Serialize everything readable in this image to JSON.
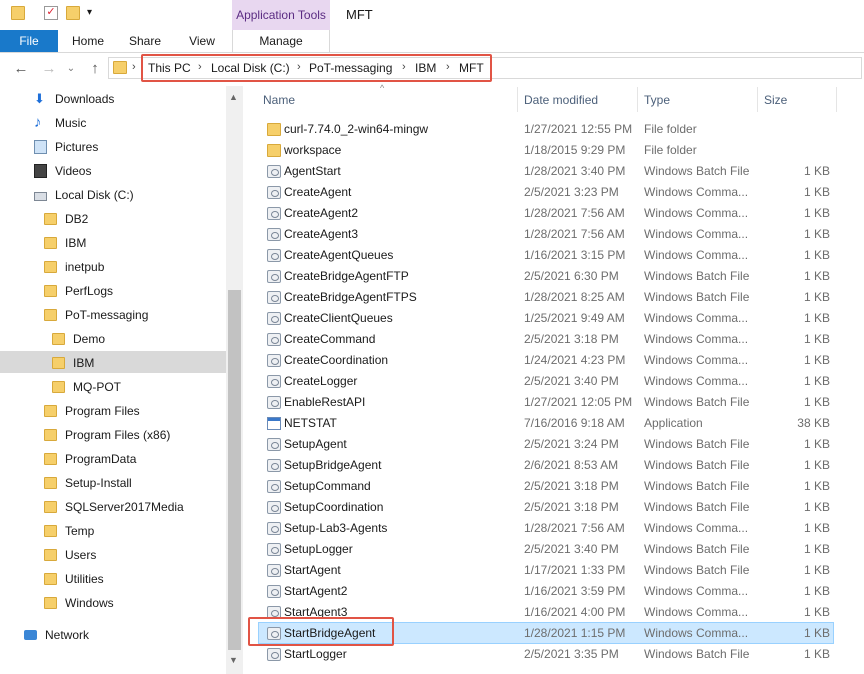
{
  "titlebar": {
    "title": "MFT",
    "contextual_tab": "Application Tools"
  },
  "ribbon": {
    "tabs": [
      "File",
      "Home",
      "Share",
      "View",
      "Manage"
    ]
  },
  "address": {
    "crumbs": [
      "This PC",
      "Local Disk (C:)",
      "PoT-messaging",
      "IBM",
      "MFT"
    ]
  },
  "nav": {
    "items": [
      {
        "label": "Downloads",
        "icon": "download-arrow-icon"
      },
      {
        "label": "Music",
        "icon": "music-note-icon"
      },
      {
        "label": "Pictures",
        "icon": "pictures-icon"
      },
      {
        "label": "Videos",
        "icon": "videos-icon"
      },
      {
        "label": "Local Disk (C:)",
        "icon": "drive-icon"
      },
      {
        "label": "DB2",
        "icon": "folder-icon"
      },
      {
        "label": "IBM",
        "icon": "folder-icon"
      },
      {
        "label": "inetpub",
        "icon": "folder-icon"
      },
      {
        "label": "PerfLogs",
        "icon": "folder-icon"
      },
      {
        "label": "PoT-messaging",
        "icon": "folder-icon"
      },
      {
        "label": "Demo",
        "icon": "folder-icon"
      },
      {
        "label": "IBM",
        "icon": "folder-icon"
      },
      {
        "label": "MQ-POT",
        "icon": "folder-icon"
      },
      {
        "label": "Program Files",
        "icon": "folder-icon"
      },
      {
        "label": "Program Files (x86)",
        "icon": "folder-icon"
      },
      {
        "label": "ProgramData",
        "icon": "folder-icon"
      },
      {
        "label": "Setup-Install",
        "icon": "folder-icon"
      },
      {
        "label": "SQLServer2017Media",
        "icon": "folder-icon"
      },
      {
        "label": "Temp",
        "icon": "folder-icon"
      },
      {
        "label": "Users",
        "icon": "folder-icon"
      },
      {
        "label": "Utilities",
        "icon": "folder-icon"
      },
      {
        "label": "Windows",
        "icon": "folder-icon"
      },
      {
        "label": "Network",
        "icon": "network-icon"
      }
    ]
  },
  "columns": {
    "name": "Name",
    "date": "Date modified",
    "type": "Type",
    "size": "Size"
  },
  "files": [
    {
      "name": "curl-7.74.0_2-win64-mingw",
      "date": "1/27/2021 12:55 PM",
      "type": "File folder",
      "size": "",
      "icon": "folder-icon"
    },
    {
      "name": "workspace",
      "date": "1/18/2015 9:29 PM",
      "type": "File folder",
      "size": "",
      "icon": "folder-icon"
    },
    {
      "name": "AgentStart",
      "date": "1/28/2021 3:40 PM",
      "type": "Windows Batch File",
      "size": "1 KB",
      "icon": "batch-file-icon"
    },
    {
      "name": "CreateAgent",
      "date": "2/5/2021 3:23 PM",
      "type": "Windows Comma...",
      "size": "1 KB",
      "icon": "batch-file-icon"
    },
    {
      "name": "CreateAgent2",
      "date": "1/28/2021 7:56 AM",
      "type": "Windows Comma...",
      "size": "1 KB",
      "icon": "batch-file-icon"
    },
    {
      "name": "CreateAgent3",
      "date": "1/28/2021 7:56 AM",
      "type": "Windows Comma...",
      "size": "1 KB",
      "icon": "batch-file-icon"
    },
    {
      "name": "CreateAgentQueues",
      "date": "1/16/2021 3:15 PM",
      "type": "Windows Comma...",
      "size": "1 KB",
      "icon": "batch-file-icon"
    },
    {
      "name": "CreateBridgeAgentFTP",
      "date": "2/5/2021 6:30 PM",
      "type": "Windows Batch File",
      "size": "1 KB",
      "icon": "batch-file-icon"
    },
    {
      "name": "CreateBridgeAgentFTPS",
      "date": "1/28/2021 8:25 AM",
      "type": "Windows Batch File",
      "size": "1 KB",
      "icon": "batch-file-icon"
    },
    {
      "name": "CreateClientQueues",
      "date": "1/25/2021 9:49 AM",
      "type": "Windows Comma...",
      "size": "1 KB",
      "icon": "batch-file-icon"
    },
    {
      "name": "CreateCommand",
      "date": "2/5/2021 3:18 PM",
      "type": "Windows Comma...",
      "size": "1 KB",
      "icon": "batch-file-icon"
    },
    {
      "name": "CreateCoordination",
      "date": "1/24/2021 4:23 PM",
      "type": "Windows Comma...",
      "size": "1 KB",
      "icon": "batch-file-icon"
    },
    {
      "name": "CreateLogger",
      "date": "2/5/2021 3:40 PM",
      "type": "Windows Comma...",
      "size": "1 KB",
      "icon": "batch-file-icon"
    },
    {
      "name": "EnableRestAPI",
      "date": "1/27/2021 12:05 PM",
      "type": "Windows Batch File",
      "size": "1 KB",
      "icon": "batch-file-icon"
    },
    {
      "name": "NETSTAT",
      "date": "7/16/2016 9:18 AM",
      "type": "Application",
      "size": "38 KB",
      "icon": "application-icon"
    },
    {
      "name": "SetupAgent",
      "date": "2/5/2021 3:24 PM",
      "type": "Windows Batch File",
      "size": "1 KB",
      "icon": "batch-file-icon"
    },
    {
      "name": "SetupBridgeAgent",
      "date": "2/6/2021 8:53 AM",
      "type": "Windows Batch File",
      "size": "1 KB",
      "icon": "batch-file-icon"
    },
    {
      "name": "SetupCommand",
      "date": "2/5/2021 3:18 PM",
      "type": "Windows Batch File",
      "size": "1 KB",
      "icon": "batch-file-icon"
    },
    {
      "name": "SetupCoordination",
      "date": "2/5/2021 3:18 PM",
      "type": "Windows Batch File",
      "size": "1 KB",
      "icon": "batch-file-icon"
    },
    {
      "name": "Setup-Lab3-Agents",
      "date": "1/28/2021 7:56 AM",
      "type": "Windows Comma...",
      "size": "1 KB",
      "icon": "batch-file-icon"
    },
    {
      "name": "SetupLogger",
      "date": "2/5/2021 3:40 PM",
      "type": "Windows Batch File",
      "size": "1 KB",
      "icon": "batch-file-icon"
    },
    {
      "name": "StartAgent",
      "date": "1/17/2021 1:33 PM",
      "type": "Windows Batch File",
      "size": "1 KB",
      "icon": "batch-file-icon"
    },
    {
      "name": "StartAgent2",
      "date": "1/16/2021 3:59 PM",
      "type": "Windows Comma...",
      "size": "1 KB",
      "icon": "batch-file-icon"
    },
    {
      "name": "StartAgent3",
      "date": "1/16/2021 4:00 PM",
      "type": "Windows Comma...",
      "size": "1 KB",
      "icon": "batch-file-icon"
    },
    {
      "name": "StartBridgeAgent",
      "date": "1/28/2021 1:15 PM",
      "type": "Windows Comma...",
      "size": "1 KB",
      "icon": "batch-file-icon"
    },
    {
      "name": "StartLogger",
      "date": "2/5/2021 3:35 PM",
      "type": "Windows Batch File",
      "size": "1 KB",
      "icon": "batch-file-icon"
    }
  ],
  "colors": {
    "accent": "#1979ca",
    "highlight": "#e15445",
    "selection": "#cce8ff",
    "folder": "#f6cf6a"
  }
}
